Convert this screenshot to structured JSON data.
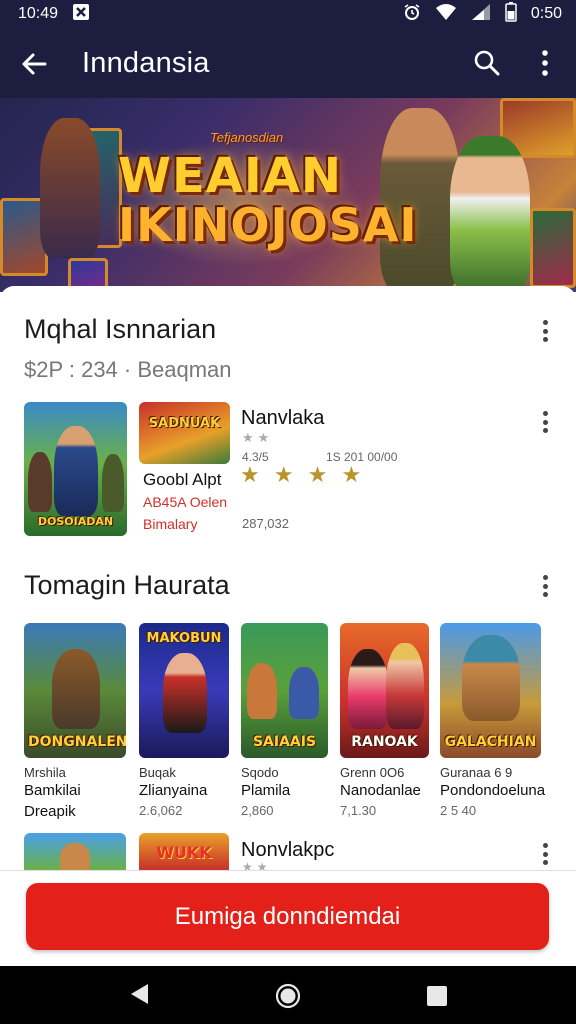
{
  "status_bar": {
    "time": "10:49",
    "battery_text": "0:50"
  },
  "app_bar": {
    "title": "Inndansia"
  },
  "banner": {
    "tagline": "Tefjanosdian",
    "logo_line1": "WEAIAN",
    "logo_line2": "IKINOJOSAI"
  },
  "section1": {
    "title": "Mqhal Isnnarian",
    "subtitle": "$2P : 234 · Beaqman",
    "thumb1_caption": "DOSOIADAN",
    "thumb2_caption": "SADNUAK",
    "featured": {
      "title": "Nanvlaka",
      "meta": "4.3/5",
      "downloads": "1S 201 00/00",
      "name": "Goobl Alpt",
      "tag1": "AB45A Oelen",
      "tag2": "Bimalary",
      "size": "287,032"
    }
  },
  "section2": {
    "title": "Tomagin Haurata",
    "games": [
      {
        "caption": "DONGNALEN",
        "line1": "Mrshila",
        "line2": "Bamkilai",
        "line3": "Dreapik"
      },
      {
        "caption": "MAKOBUN",
        "line1": "Buqak",
        "line2": "Zlianyaina",
        "line3": "2.6,062"
      },
      {
        "caption": "SAIAAIS",
        "line1": "Sqodo",
        "line2": "Plamila",
        "line3": "2,860"
      },
      {
        "caption": "RANOAK",
        "line1": "Grenn 0O6",
        "line2": "Nanodanlae",
        "line3": "7,1.30"
      },
      {
        "caption": "GALACHIAN",
        "line1": "Guranaa 6 9",
        "line2": "Pondondoeluna",
        "line3": "2 5 40"
      }
    ]
  },
  "section3": {
    "thumb2_caption": "WUKK",
    "featured_title": "Nonvlakpc"
  },
  "cta": {
    "label": "Eumiga donndiemdai"
  },
  "colors": {
    "appbar": "#1d1d3f",
    "accent": "#e32019",
    "star": "#b8942a"
  },
  "icons": [
    "arrow-back-icon",
    "search-icon",
    "more-vert-icon",
    "nav-back-icon",
    "nav-home-icon",
    "nav-recents-icon"
  ]
}
